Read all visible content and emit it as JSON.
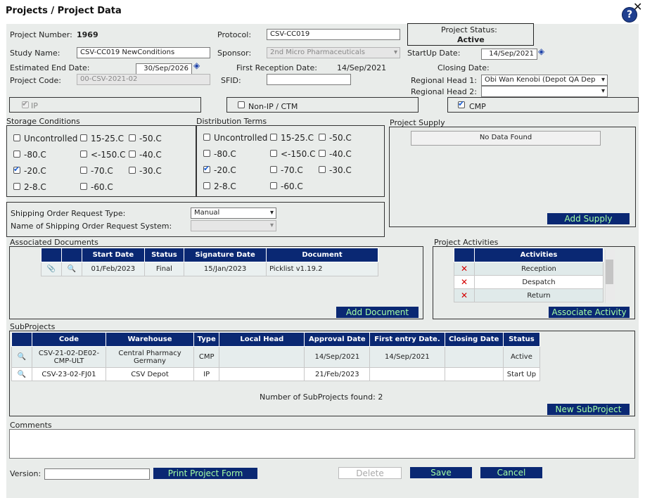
{
  "header": {
    "title": "Projects / Project Data",
    "help": "?",
    "close": "✕"
  },
  "fields": {
    "project_number_label": "Project Number:",
    "project_number": "1969",
    "protocol_label": "Protocol:",
    "protocol": "CSV-CC019",
    "project_status_label": "Project Status:",
    "project_status": "Active",
    "study_name_label": "Study Name:",
    "study_name": "CSV-CC019 NewConditions",
    "sponsor_label": "Sponsor:",
    "sponsor": "2nd Micro Pharmaceuticals",
    "startup_date_label": "StartUp Date:",
    "startup_date": "14/Sep/2021",
    "est_end_date_label": "Estimated End Date:",
    "est_end_date": "30/Sep/2026",
    "first_reception_label": "First Reception Date:",
    "first_reception": "14/Sep/2021",
    "closing_date_label": "Closing Date:",
    "project_code_label": "Project Code:",
    "project_code": "00-CSV-2021-02",
    "sfid_label": "SFID:",
    "sfid": "",
    "regional_head1_label": "Regional Head 1:",
    "regional_head1": "Obi Wan Kenobi (Depot QA Dep",
    "regional_head2_label": "Regional Head 2:",
    "regional_head2": ""
  },
  "types": {
    "ip": "IP",
    "non_ip": "Non-IP / CTM",
    "cmp": "CMP"
  },
  "storage": {
    "title": "Storage Conditions",
    "items": [
      "Uncontrolled",
      "15-25.C",
      "-50.C",
      "-80.C",
      "<-150.C",
      "-40.C",
      "-20.C",
      "-70.C",
      "-30.C",
      "2-8.C",
      "-60.C"
    ]
  },
  "distribution": {
    "title": "Distribution Terms",
    "items": [
      "Uncontrolled",
      "15-25.C",
      "-50.C",
      "-80.C",
      "<-150.C",
      "-40.C",
      "-20.C",
      "-70.C",
      "-30.C",
      "2-8.C",
      "-60.C"
    ]
  },
  "supply": {
    "title": "Project Supply",
    "nodata": "No Data Found",
    "add": "Add Supply"
  },
  "shipping": {
    "type_label": "Shipping Order Request Type:",
    "type_value": "Manual",
    "system_label": "Name of Shipping Order Request System:",
    "system_value": ""
  },
  "documents": {
    "title": "Associated Documents",
    "headers": [
      "Start Date",
      "Status",
      "Signature Date",
      "Document"
    ],
    "rows": [
      {
        "start": "01/Feb/2023",
        "status": "Final",
        "signature": "15/Jan/2023",
        "doc": "Picklist v1.19.2"
      }
    ],
    "add": "Add Document"
  },
  "activities": {
    "title": "Project Activities",
    "header": "Activities",
    "rows": [
      "Reception",
      "Despatch",
      "Return"
    ],
    "add": "Associate Activity"
  },
  "subprojects": {
    "title": "SubProjects",
    "headers": [
      "Code",
      "Warehouse",
      "Type",
      "Local Head",
      "Approval Date",
      "First entry Date.",
      "Closing Date",
      "Status"
    ],
    "rows": [
      {
        "code": "CSV-21-02-DE02-CMP-ULT",
        "warehouse": "Central Pharmacy Germany",
        "type": "CMP",
        "local": "",
        "approval": "14/Sep/2021",
        "first": "14/Sep/2021",
        "closing": "",
        "status": "Active"
      },
      {
        "code": "CSV-23-02-FJ01",
        "warehouse": "CSV Depot",
        "type": "IP",
        "local": "",
        "approval": "21/Feb/2023",
        "first": "",
        "closing": "",
        "status": "Start Up"
      }
    ],
    "count_text": "Number of SubProjects found: 2",
    "add": "New SubProject"
  },
  "comments": {
    "label": "Comments",
    "value": ""
  },
  "footer": {
    "version_label": "Version:",
    "version": "",
    "print": "Print Project Form",
    "delete": "Delete",
    "save": "Save",
    "cancel": "Cancel"
  },
  "colors": {
    "button_bg": "#0a2873",
    "button_text": "#a4ffa4",
    "panel_bg": "#e9ecea",
    "header_bg": "#0a2873"
  }
}
